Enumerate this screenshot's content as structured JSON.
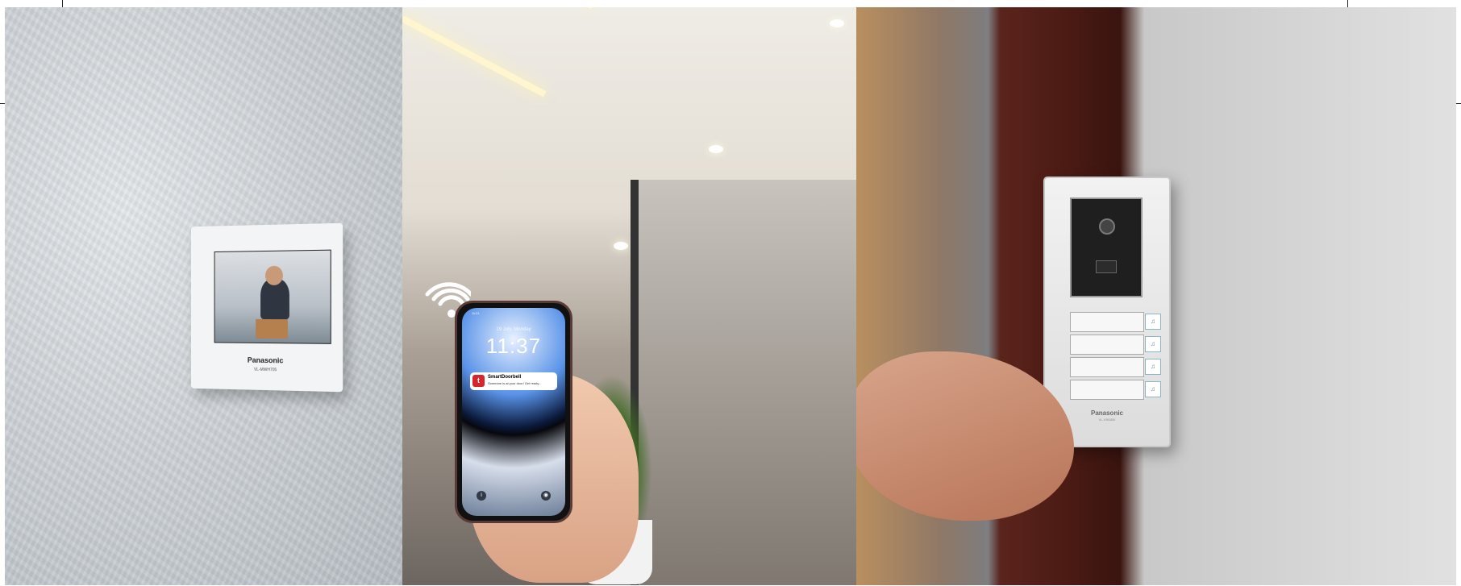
{
  "monitor": {
    "brand": "Panasonic",
    "model": "VL-MWH705"
  },
  "phone": {
    "status_time": "11:21",
    "date": "19 July, Monday",
    "time": "11:37",
    "notification": {
      "app": "SmartDoorbell",
      "body": "Someone is at your door! Get ready..."
    }
  },
  "door_station": {
    "brand": "Panasonic",
    "model": "VL-V901BX"
  }
}
